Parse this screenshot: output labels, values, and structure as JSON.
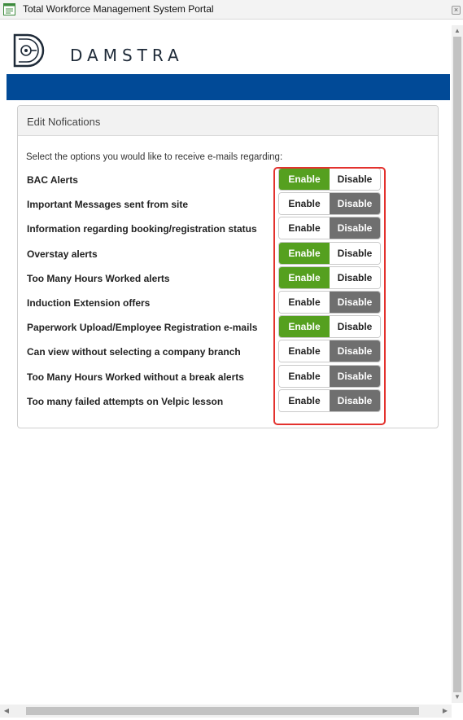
{
  "window": {
    "title": "Total Workforce Management System Portal",
    "app_icon": "document-window-icon",
    "close_icon": "close-icon"
  },
  "brand": {
    "name": "DAMSTRA",
    "logo_icon": "damstra-logo",
    "band_color": "#014a97"
  },
  "panel": {
    "title": "Edit Nofications",
    "intro": "Select the options you would like to receive e-mails regarding:"
  },
  "toggle_labels": {
    "enable": "Enable",
    "disable": "Disable"
  },
  "colors": {
    "enabled": "#55a01f",
    "disabled": "#6f6f6f",
    "highlight": "#e3322e"
  },
  "notifications": [
    {
      "label": "BAC Alerts",
      "state": "enable"
    },
    {
      "label": "Important Messages sent from site",
      "state": "disable"
    },
    {
      "label": "Information regarding booking/registration status",
      "state": "disable"
    },
    {
      "label": "Overstay alerts",
      "state": "enable"
    },
    {
      "label": "Too Many Hours Worked alerts",
      "state": "enable"
    },
    {
      "label": "Induction Extension offers",
      "state": "disable"
    },
    {
      "label": "Paperwork Upload/Employee Registration e-mails",
      "state": "enable"
    },
    {
      "label": "Can view without selecting a company branch",
      "state": "disable"
    },
    {
      "label": "Too Many Hours Worked without a break alerts",
      "state": "disable"
    },
    {
      "label": "Too many failed attempts on Velpic lesson",
      "state": "disable"
    }
  ]
}
